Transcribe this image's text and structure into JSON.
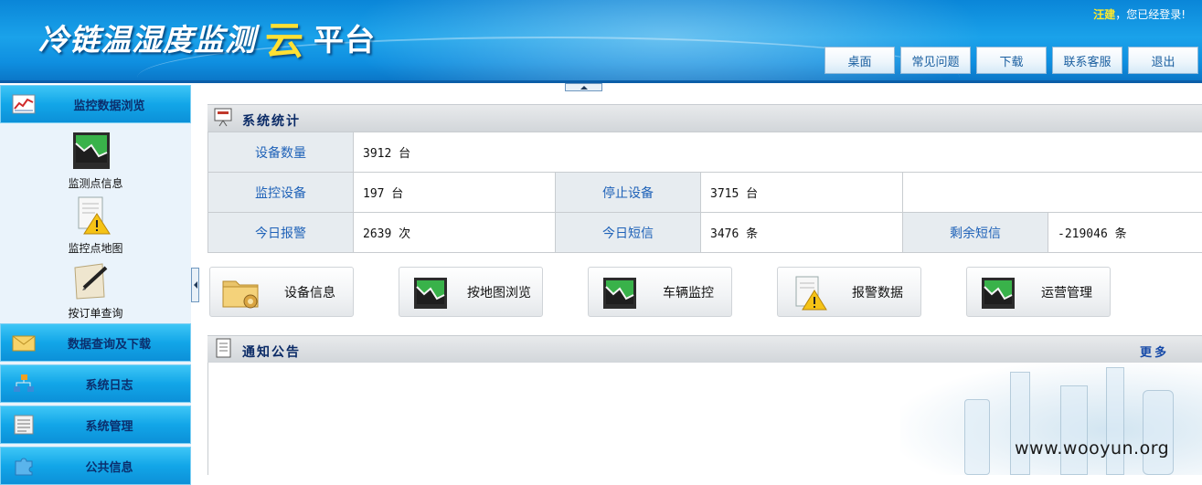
{
  "header": {
    "title_main": "冷链温湿度监测",
    "title_cloud": "云",
    "title_rest": "平台",
    "user_name": "汪建",
    "login_suffix": "，您已经登录!",
    "nav": [
      "桌面",
      "常见问题",
      "下载",
      "联系客服",
      "退出"
    ]
  },
  "sidebar": {
    "sections": [
      {
        "label": "监控数据浏览",
        "icon": "chart-icon"
      },
      {
        "label": "数据查询及下载",
        "icon": "envelope-icon"
      },
      {
        "label": "系统日志",
        "icon": "network-icon"
      },
      {
        "label": "系统管理",
        "icon": "list-icon"
      },
      {
        "label": "公共信息",
        "icon": "puzzle-icon"
      }
    ],
    "items": [
      {
        "label": "监测点信息",
        "icon": "trend-chart-icon"
      },
      {
        "label": "监控点地图",
        "icon": "warning-document-icon"
      },
      {
        "label": "按订单查询",
        "icon": "pen-note-icon"
      }
    ]
  },
  "stats": {
    "title": "系统统计",
    "rows": [
      [
        {
          "label": "设备数量",
          "value": "3912 台"
        }
      ],
      [
        {
          "label": "监控设备",
          "value": "197 台"
        },
        {
          "label": "停止设备",
          "value": "3715 台"
        }
      ],
      [
        {
          "label": "今日报警",
          "value": "2639 次"
        },
        {
          "label": "今日短信",
          "value": "3476 条"
        },
        {
          "label": "剩余短信",
          "value": "-219046 条"
        }
      ]
    ]
  },
  "quick_buttons": [
    {
      "label": "设备信息",
      "icon": "folder-gear-icon"
    },
    {
      "label": "按地图浏览",
      "icon": "trend-chart-icon"
    },
    {
      "label": "车辆监控",
      "icon": "trend-chart-icon"
    },
    {
      "label": "报警数据",
      "icon": "warning-document-icon"
    },
    {
      "label": "运营管理",
      "icon": "trend-chart-icon"
    }
  ],
  "notice": {
    "title": "通知公告",
    "more": "更多"
  },
  "watermark": "www.wooyun.org",
  "colors": {
    "header_blue": "#0a86d8",
    "sidebar_section": "#12a6e8",
    "label_blue": "#1f62b8",
    "title_navy": "#0a2a66",
    "cloud_yellow": "#ffe033"
  }
}
